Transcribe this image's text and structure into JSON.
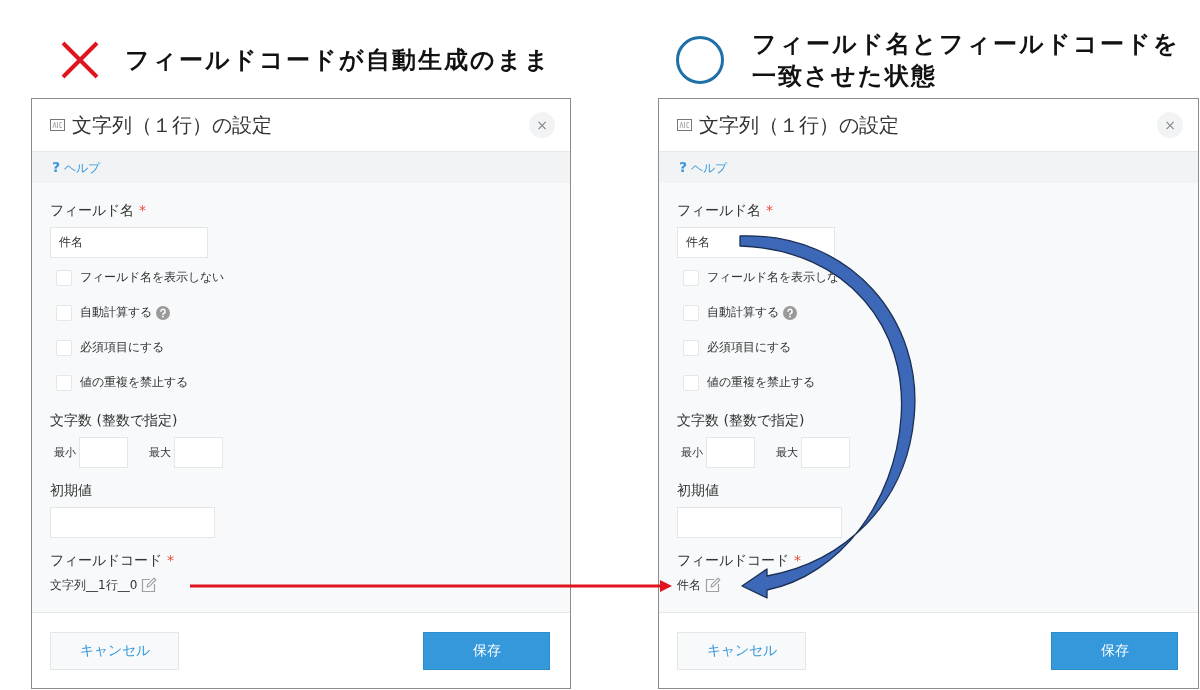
{
  "comparisons": [
    {
      "kind": "cross",
      "caption": "フィールドコードが自動生成のまま",
      "dialog": {
        "title": "文字列（１行）の設定",
        "close": "×",
        "help_mark": "?",
        "help": "ヘルプ",
        "field_name": {
          "label": "フィールド名",
          "required_mark": "*",
          "value": "件名"
        },
        "options": [
          {
            "label": "フィールド名を表示しない",
            "checked": false,
            "has_help": false
          },
          {
            "label": "自動計算する",
            "checked": false,
            "has_help": true
          },
          {
            "label": "必須項目にする",
            "checked": false,
            "has_help": false
          },
          {
            "label": "値の重複を禁止する",
            "checked": false,
            "has_help": false
          }
        ],
        "char_count": {
          "label": "文字数 (整数で指定)",
          "min_label": "最小",
          "max_label": "最大"
        },
        "default_value": {
          "label": "初期値"
        },
        "field_code": {
          "label": "フィールドコード",
          "required_mark": "*",
          "value": "文字列__1行__0"
        },
        "buttons": [
          {
            "label": "キャンセル",
            "kind": "secondary"
          },
          {
            "label": "保存",
            "kind": "primary"
          }
        ]
      }
    },
    {
      "kind": "circle",
      "caption": "フィールド名とフィールドコードを一致させた状態",
      "dialog": {
        "title": "文字列（１行）の設定",
        "close": "×",
        "help_mark": "?",
        "help": "ヘルプ",
        "field_name": {
          "label": "フィールド名",
          "required_mark": "*",
          "value": "件名"
        },
        "options": [
          {
            "label": "フィールド名を表示しな",
            "checked": false,
            "has_help": false
          },
          {
            "label": "自動計算する",
            "checked": false,
            "has_help": true
          },
          {
            "label": "必須項目にする",
            "checked": false,
            "has_help": false
          },
          {
            "label": "値の重複を禁止する",
            "checked": false,
            "has_help": false
          }
        ],
        "char_count": {
          "label": "文字数 (整数で指定)",
          "min_label": "最小",
          "max_label": "最大"
        },
        "default_value": {
          "label": "初期値"
        },
        "field_code": {
          "label": "フィールドコード",
          "required_mark": "*",
          "value": "件名"
        },
        "buttons": [
          {
            "label": "キャンセル",
            "kind": "secondary"
          },
          {
            "label": "保存",
            "kind": "primary"
          }
        ]
      }
    }
  ]
}
